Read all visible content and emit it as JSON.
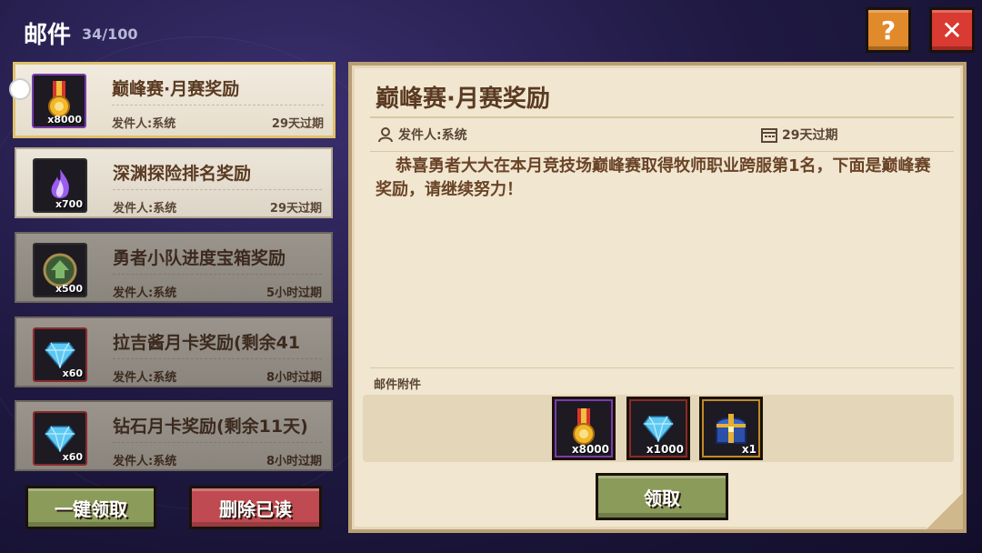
{
  "header": {
    "title": "邮件",
    "count": "34/100",
    "help_label": "?",
    "close_label": "✕"
  },
  "mails": [
    {
      "title": "巅峰赛·月赛奖励",
      "sender": "发件人:系统",
      "expire": "29天过期",
      "qty": "x8000",
      "icon": "medal-icon",
      "state": "selected"
    },
    {
      "title": "深渊探险排名奖励",
      "sender": "发件人:系统",
      "expire": "29天过期",
      "qty": "x700",
      "icon": "purple-flame-icon",
      "state": "unread"
    },
    {
      "title": "勇者小队进度宝箱奖励",
      "sender": "发件人:系统",
      "expire": "5小时过期",
      "qty": "x500",
      "icon": "green-emblem-icon",
      "state": "read"
    },
    {
      "title": "拉吉酱月卡奖励(剩余41",
      "sender": "发件人:系统",
      "expire": "8小时过期",
      "qty": "x60",
      "icon": "diamond-icon",
      "state": "read"
    },
    {
      "title": "钻石月卡奖励(剩余11天)",
      "sender": "发件人:系统",
      "expire": "8小时过期",
      "qty": "x60",
      "icon": "diamond-icon",
      "state": "read"
    }
  ],
  "buttons": {
    "claim_all": "一键领取",
    "delete_read": "删除已读",
    "claim": "领取"
  },
  "detail": {
    "title": "巅峰赛·月赛奖励",
    "sender": "发件人:系统",
    "expire": "29天过期",
    "body": "恭喜勇者大大在本月竞技场巅峰赛取得牧师职业跨服第1名，下面是巅峰赛奖励，请继续努力！",
    "attachments_label": "邮件附件",
    "attachments": [
      {
        "icon": "medal-icon",
        "qty": "x8000",
        "frame_color": "#7a3bb0"
      },
      {
        "icon": "diamond-icon",
        "qty": "x1000",
        "frame_color": "#8a2a2a"
      },
      {
        "icon": "treasure-chest-icon",
        "qty": "x1",
        "frame_color": "#c08a2a"
      }
    ]
  }
}
